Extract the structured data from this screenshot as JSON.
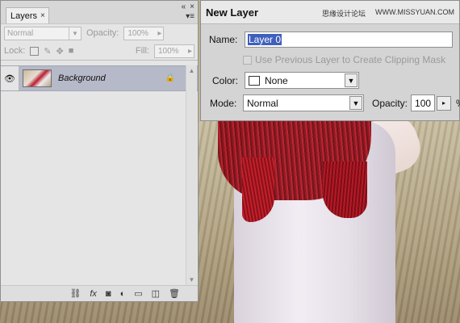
{
  "layers_panel": {
    "tab_label": "Layers",
    "tab_close": "×",
    "collapse_glyph": "«",
    "close_glyph": "×",
    "menu_glyph": "▾≡",
    "blend_mode": "Normal",
    "opacity_label": "Opacity:",
    "opacity_value": "100%",
    "lock_label": "Lock:",
    "fill_label": "Fill:",
    "fill_value": "100%",
    "layers": [
      {
        "name": "Background",
        "visible": true,
        "locked": true
      }
    ],
    "footer_icons": [
      "link-icon",
      "fx-icon",
      "mask-icon",
      "adjustment-icon",
      "group-icon",
      "new-layer-icon",
      "trash-icon"
    ]
  },
  "dialog": {
    "title": "New Layer",
    "watermark_cn": "思缘设计论坛",
    "watermark_url": "WWW.MISSYUAN.COM",
    "name_label": "Name:",
    "name_value": "Layer 0",
    "clip_label": "Use Previous Layer to Create Clipping Mask",
    "color_label": "Color:",
    "color_value": "None",
    "mode_label": "Mode:",
    "mode_value": "Normal",
    "opacity_label": "Opacity:",
    "opacity_value": "100",
    "opacity_unit": "%"
  },
  "colors": {
    "selection_bg": "#3f5fbd",
    "layer_row_bg": "#b5b9c8"
  }
}
